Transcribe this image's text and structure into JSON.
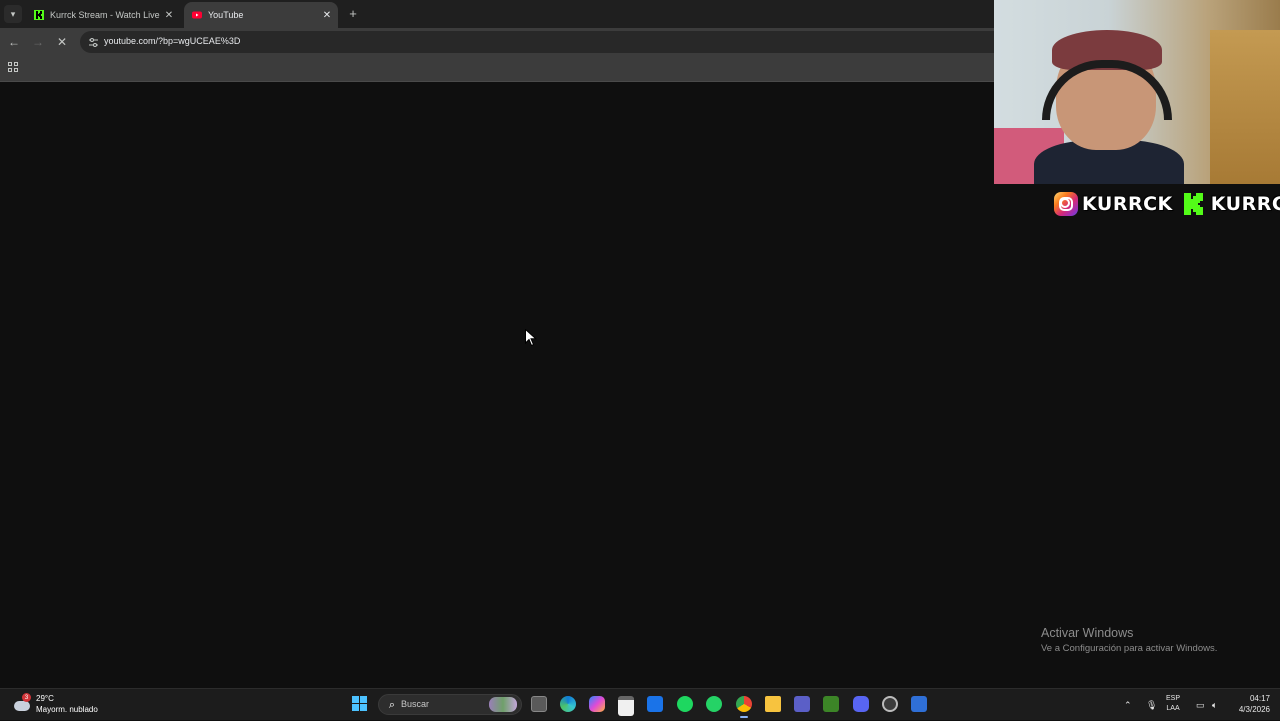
{
  "browser": {
    "tabs": [
      {
        "title": "Kurrck Stream - Watch Live on K",
        "active": false,
        "favicon": "kick-favicon"
      },
      {
        "title": "YouTube",
        "active": true,
        "favicon": "youtube-favicon"
      }
    ],
    "new_tab_icon": "+",
    "url": "youtube.com/?bp=wgUCEAE%3D",
    "loading": true
  },
  "content": {
    "background": "#0f0f0f",
    "watermark_title": "Activar Windows",
    "watermark_subtitle": "Ve a Configuración para activar Windows."
  },
  "overlay": {
    "instagram_handle": "KURRCK",
    "kick_handle": "KURRCK"
  },
  "taskbar": {
    "weather_badge": "3",
    "weather_temp": "29°C",
    "weather_desc": "Mayorm. nublado",
    "search_placeholder": "Buscar",
    "lang_top": "ESP",
    "lang_bottom": "LAA",
    "time": "04:17",
    "date": "4/3/2026",
    "apps": [
      "task-view-icon",
      "edge-icon",
      "copilot-icon",
      "store-icon",
      "outlook-icon",
      "spotify-icon",
      "whatsapp-icon",
      "chrome-icon",
      "file-explorer-icon",
      "teams-icon",
      "minecraft-icon",
      "discord-icon",
      "obs-icon",
      "app-icon"
    ]
  },
  "colors": {
    "accent_blue": "#4cc2ff",
    "kick_green": "#53fc18",
    "youtube_red": "#ff0033"
  }
}
